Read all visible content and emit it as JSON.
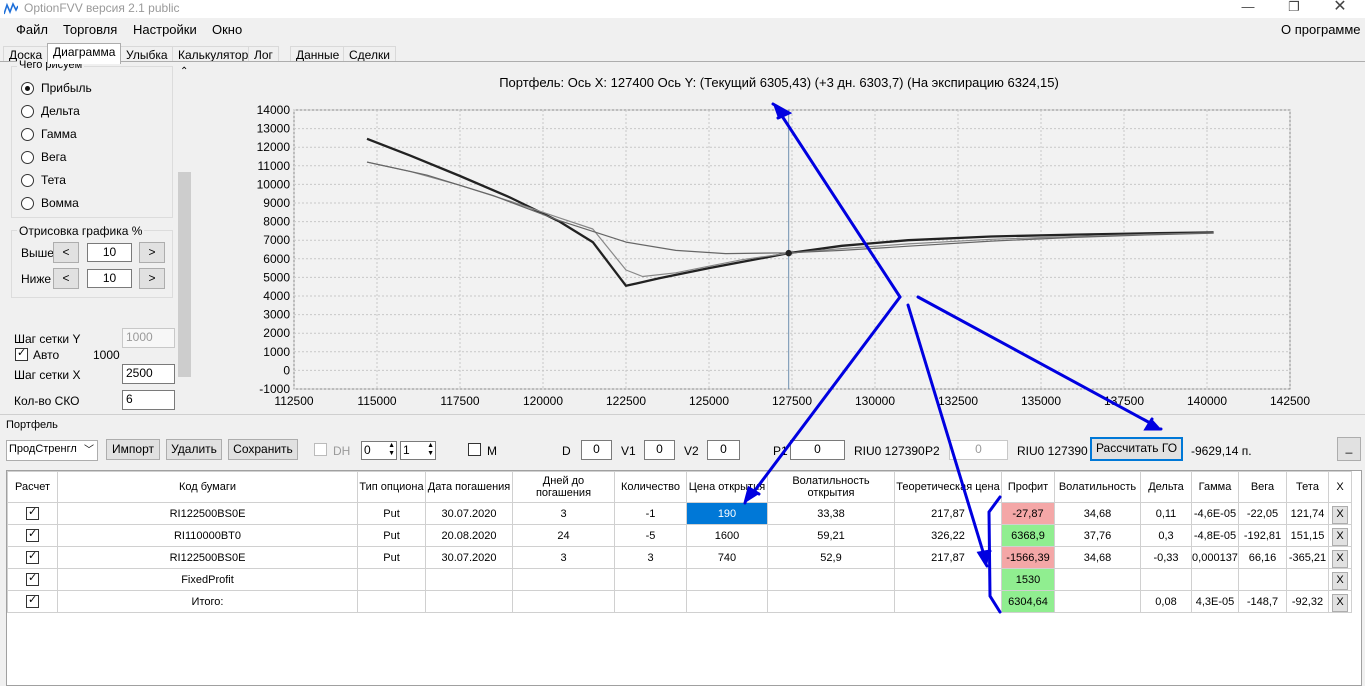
{
  "window": {
    "title": "OptionFVV версия 2.1 public"
  },
  "menu": {
    "items": [
      "Файл",
      "Торговля",
      "Настройки",
      "Окно"
    ],
    "about": "О программе"
  },
  "tabs": [
    "Доска",
    "Диаграмма",
    "Улыбка",
    "Калькулятор",
    "Лог",
    "Данные",
    "Сделки"
  ],
  "left": {
    "what_title": "Чего рисуем",
    "radios": [
      "Прибыль",
      "Дельта",
      "Гамма",
      "Вега",
      "Тета",
      "Вомма"
    ],
    "selected": 0,
    "render_title": "Отрисовка графика %",
    "above_label": "Выше",
    "above_value": "10",
    "below_label": "Ниже",
    "below_value": "10",
    "btn_left": "<",
    "btn_right": ">",
    "grid_y_label": "Шаг сетки Y",
    "grid_y_value": "1000",
    "auto_label": "Авто",
    "auto_value": "1000",
    "grid_x_label": "Шаг сетки X",
    "grid_x_value": "2500",
    "sko_label": "Кол-во СКО",
    "sko_value": "6"
  },
  "chart_data": {
    "type": "line",
    "title": "Портфель: Ось X: 127400 Ось Y:  (Текущий 6305,43)  (+3 дн. 6303,7)  (На экспирацию 6324,15)",
    "xlabel": "",
    "ylabel": "",
    "xlim": [
      112500,
      142500
    ],
    "ylim": [
      -1000,
      14000
    ],
    "xticks": [
      "112500",
      "115000",
      "117500",
      "120000",
      "122500",
      "125000",
      "127500",
      "130000",
      "132500",
      "135000",
      "137500",
      "140000",
      "142500"
    ],
    "yticks": [
      "14000",
      "13000",
      "12000",
      "11000",
      "10000",
      "9000",
      "8000",
      "7000",
      "6000",
      "5000",
      "4000",
      "3000",
      "2000",
      "1000",
      "0",
      "-1000"
    ],
    "grid": true,
    "vline_x": 127400,
    "marker": {
      "x": 127400,
      "y": 6305
    },
    "series": [
      {
        "values": [
          [
            114700,
            12450
          ],
          [
            116000,
            11550
          ],
          [
            117500,
            10450
          ],
          [
            119000,
            9300
          ],
          [
            120500,
            8000
          ],
          [
            121500,
            6900
          ],
          [
            122500,
            4550
          ],
          [
            123500,
            4950
          ],
          [
            125000,
            5500
          ],
          [
            126500,
            6000
          ],
          [
            127400,
            6305
          ],
          [
            129000,
            6700
          ],
          [
            131000,
            7000
          ],
          [
            133500,
            7200
          ],
          [
            136000,
            7300
          ],
          [
            138500,
            7380
          ],
          [
            140200,
            7420
          ]
        ]
      },
      {
        "values": [
          [
            114700,
            11200
          ],
          [
            116000,
            10700
          ],
          [
            117500,
            9950
          ],
          [
            119000,
            9100
          ],
          [
            120500,
            8200
          ],
          [
            121500,
            7600
          ],
          [
            122500,
            5400
          ],
          [
            123000,
            5050
          ],
          [
            124000,
            5250
          ],
          [
            125000,
            5600
          ],
          [
            126000,
            5950
          ],
          [
            127400,
            6300
          ],
          [
            129000,
            6550
          ],
          [
            131000,
            6800
          ],
          [
            133500,
            7050
          ],
          [
            136000,
            7200
          ],
          [
            138500,
            7330
          ],
          [
            140200,
            7400
          ]
        ]
      },
      {
        "values": [
          [
            114700,
            11200
          ],
          [
            116500,
            10500
          ],
          [
            118500,
            9400
          ],
          [
            120500,
            8050
          ],
          [
            122500,
            6900
          ],
          [
            124000,
            6450
          ],
          [
            125500,
            6280
          ],
          [
            127400,
            6320
          ],
          [
            129000,
            6450
          ],
          [
            131000,
            6680
          ],
          [
            133500,
            6950
          ],
          [
            136000,
            7150
          ],
          [
            138500,
            7300
          ],
          [
            140200,
            7380
          ]
        ]
      }
    ]
  },
  "portfolio": {
    "label": "Портфель",
    "select": "ПродСтренгл",
    "import": "Импорт",
    "delete": "Удалить",
    "save": "Сохранить",
    "dh": "DH",
    "spin1": "0",
    "spin2": "1",
    "m": "M",
    "d_label": "D",
    "d_value": "0",
    "v1_label": "V1",
    "v1_value": "0",
    "v2_label": "V2",
    "v2_value": "0",
    "p1_label": "P1",
    "p1_value": "0",
    "riu1": "RIU0 127390",
    "p2_label": "P2",
    "p2_value": "0",
    "riu2": "RIU0 127390",
    "calc_go": "Рассчитать ГО",
    "go_value": "-9629,14 п.",
    "min_btn": "_"
  },
  "table": {
    "headers": [
      "Расчет",
      "Код бумаги",
      "Тип опциона",
      "Дата погашения",
      "Дней до погашения",
      "Количество",
      "Цена открытия",
      "Волатильность открытия",
      "Теоретическая цена",
      "Профит",
      "Волатильность",
      "Дельта",
      "Гамма",
      "Вега",
      "Тета",
      "X"
    ],
    "rows": [
      [
        "RI122500BS0E",
        "Put",
        "30.07.2020",
        "3",
        "-1",
        "190",
        "33,38",
        "217,87",
        "-27,87",
        "34,68",
        "0,11",
        "-4,6E-05",
        "-22,05",
        "121,74"
      ],
      [
        "RI110000BT0",
        "Put",
        "20.08.2020",
        "24",
        "-5",
        "1600",
        "59,21",
        "326,22",
        "6368,9",
        "37,76",
        "0,3",
        "-4,8E-05",
        "-192,81",
        "151,15"
      ],
      [
        "RI122500BS0E",
        "Put",
        "30.07.2020",
        "3",
        "3",
        "740",
        "52,9",
        "217,87",
        "-1566,39",
        "34,68",
        "-0,33",
        "0,000137",
        "66,16",
        "-365,21"
      ],
      [
        "FixedProfit",
        "",
        "",
        "",
        "",
        "",
        "",
        "",
        "1530",
        "",
        "",
        "",
        "",
        ""
      ],
      [
        "Итого:",
        "",
        "",
        "",
        "",
        "",
        "",
        "",
        "6304,64",
        "",
        "0,08",
        "4,3E-05",
        "-148,7",
        "-92,32"
      ]
    ],
    "x_label": "X"
  },
  "colors": {
    "annotation": "#0000e0",
    "selected_cell": "#0078d7",
    "loss": "#f4a7a7",
    "gain": "#90ee90"
  }
}
